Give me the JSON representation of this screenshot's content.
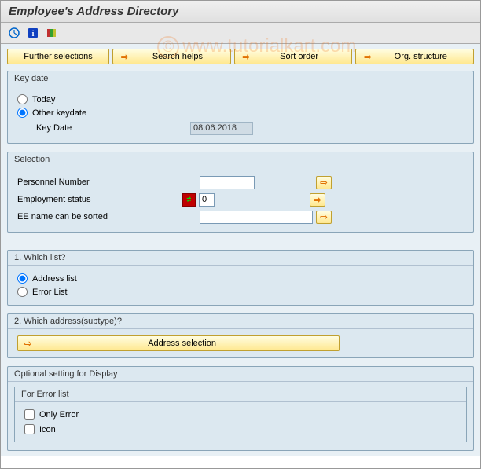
{
  "header": {
    "title": "Employee's Address Directory"
  },
  "watermark": "www.tutorialkart.com",
  "topButtons": {
    "further": "Further selections",
    "search": "Search helps",
    "sort": "Sort order",
    "org": "Org. structure"
  },
  "keydate": {
    "group_title": "Key date",
    "today": "Today",
    "other": "Other keydate",
    "label": "Key Date",
    "value": "08.06.2018"
  },
  "selection": {
    "group_title": "Selection",
    "pernr": "Personnel Number",
    "status": "Employment status",
    "status_val": "0",
    "ename": "EE name can be sorted"
  },
  "section1": {
    "title": "1. Which list?",
    "address": "Address list",
    "error": "Error List"
  },
  "section2": {
    "title": "2. Which address(subtype)?",
    "btn": "Address selection"
  },
  "optional": {
    "title": "Optional setting for Display",
    "sub": "For Error list",
    "only_error": "Only Error",
    "icon": "Icon"
  }
}
